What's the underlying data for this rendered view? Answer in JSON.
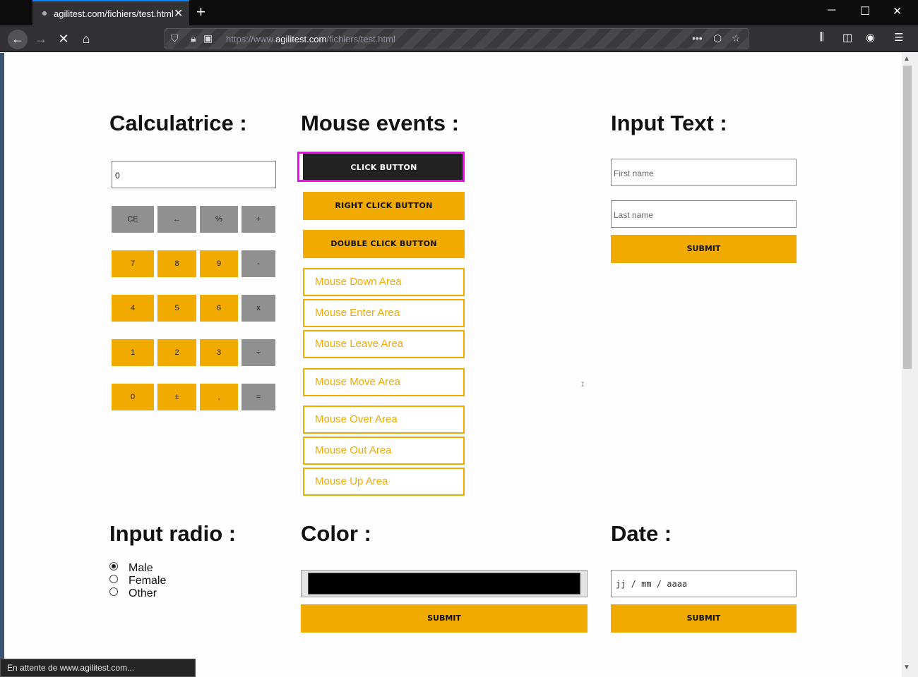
{
  "browser": {
    "tab_title": "agilitest.com/fichiers/test.html",
    "url_prefix": "https://www.",
    "url_host": "agilitest.com",
    "url_path": "/fichiers/test.html",
    "status": "En attente de www.agilitest.com..."
  },
  "calc": {
    "title": "Calculatrice :",
    "display": "0",
    "keys": [
      [
        "CE",
        "←",
        "%",
        "+"
      ],
      [
        "7",
        "8",
        "9",
        "-"
      ],
      [
        "4",
        "5",
        "6",
        "x"
      ],
      [
        "1",
        "2",
        "3",
        "÷"
      ],
      [
        "0",
        "±",
        ",",
        "="
      ]
    ]
  },
  "mouse": {
    "title": "Mouse events :",
    "click": "CLICK BUTTON",
    "right_click": "RIGHT CLICK BUTTON",
    "double_click": "DOUBLE CLICK BUTTON",
    "areas": [
      "Mouse Down Area",
      "Mouse Enter Area",
      "Mouse Leave Area",
      "Mouse Move Area",
      "Mouse Over Area",
      "Mouse Out Area",
      "Mouse Up Area"
    ]
  },
  "input_text": {
    "title": "Input Text :",
    "first_placeholder": "First name",
    "last_placeholder": "Last name",
    "submit": "SUBMIT"
  },
  "radio": {
    "title": "Input radio :",
    "options": [
      "Male",
      "Female",
      "Other"
    ],
    "selected": "Male"
  },
  "color": {
    "title": "Color :",
    "value": "#000000",
    "submit": "SUBMIT"
  },
  "date": {
    "title": "Date :",
    "placeholder": "jj / mm / aaaa",
    "submit": "SUBMIT"
  },
  "colors": {
    "accent": "#f0aa00",
    "gray": "#909090",
    "dark": "#222222",
    "highlight": "#ff00ff"
  }
}
